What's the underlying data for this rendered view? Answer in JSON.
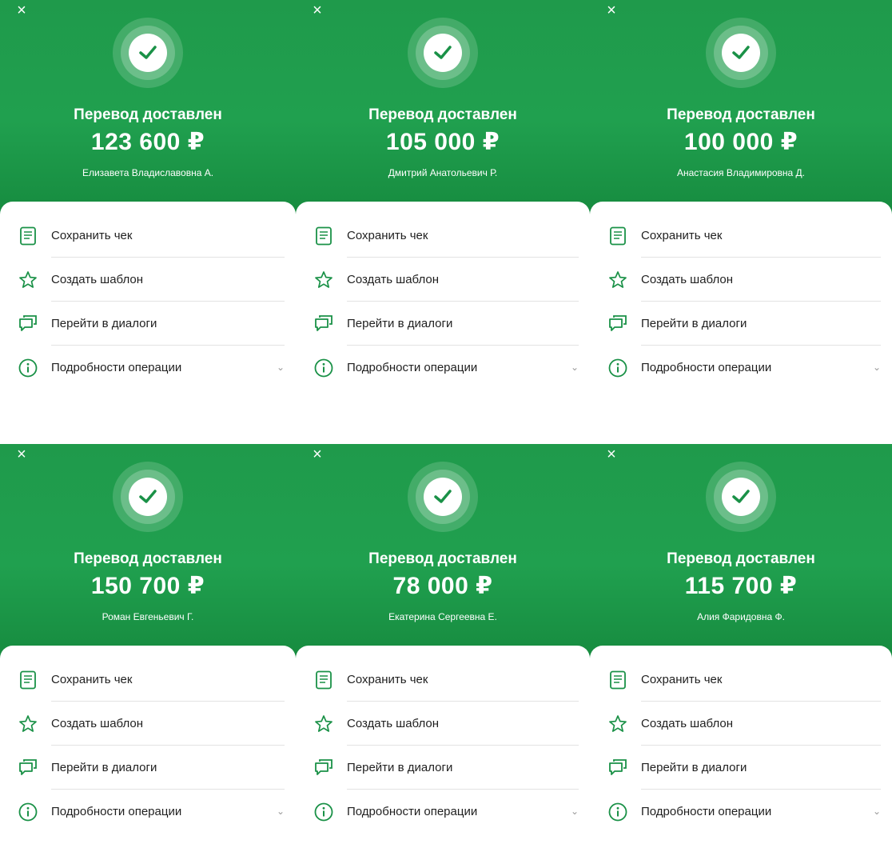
{
  "close_symbol": "×",
  "accent_color": "#21a038",
  "icons": [
    "receipt-icon",
    "star-icon",
    "chat-icon",
    "info-icon",
    "chevron-down-icon",
    "check-icon",
    "close-icon"
  ],
  "panels": [
    {
      "status": "Перевод доставлен",
      "amount": "123 600 ₽",
      "recipient": "Елизавета Владиславовна А.",
      "menu": [
        "Сохранить чек",
        "Создать шаблон",
        "Перейти в диалоги",
        "Подробности операции"
      ]
    },
    {
      "status": "Перевод доставлен",
      "amount": "105 000 ₽",
      "recipient": "Дмитрий Анатольевич Р.",
      "menu": [
        "Сохранить чек",
        "Создать шаблон",
        "Перейти в диалоги",
        "Подробности операции"
      ]
    },
    {
      "status": "Перевод доставлен",
      "amount": "100 000 ₽",
      "recipient": "Анастасия Владимировна Д.",
      "menu": [
        "Сохранить чек",
        "Создать шаблон",
        "Перейти в диалоги",
        "Подробности операции"
      ]
    },
    {
      "status": "Перевод доставлен",
      "amount": "150 700 ₽",
      "recipient": "Роман Евгеньевич Г.",
      "menu": [
        "Сохранить чек",
        "Создать шаблон",
        "Перейти в диалоги",
        "Подробности операции"
      ]
    },
    {
      "status": "Перевод доставлен",
      "amount": "78 000 ₽",
      "recipient": "Екатерина Сергеевна Е.",
      "menu": [
        "Сохранить чек",
        "Создать шаблон",
        "Перейти в диалоги",
        "Подробности операции"
      ]
    },
    {
      "status": "Перевод доставлен",
      "amount": "115 700 ₽",
      "recipient": "Алия Фаридовна Ф.",
      "menu": [
        "Сохранить чек",
        "Создать шаблон",
        "Перейти в диалоги",
        "Подробности операции"
      ]
    }
  ]
}
